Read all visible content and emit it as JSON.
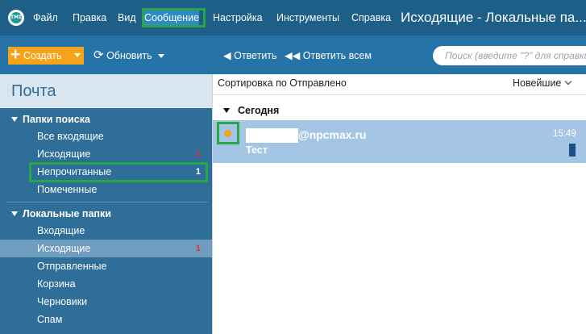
{
  "menubar": {
    "logo_text": "ΤΜΣ",
    "items": [
      "Файл",
      "Правка",
      "Вид",
      "Сообщение",
      "Настройка",
      "Инструменты",
      "Справка"
    ],
    "window_title": "Исходящие - Локальные па..."
  },
  "toolbar": {
    "create": "Создать",
    "refresh": "Обновить",
    "reply": "Ответить",
    "reply_all": "Ответить всем",
    "search_placeholder": "Поиск (введите \"?\" для справки)"
  },
  "sidebar": {
    "title": "Почта",
    "search_group": {
      "label": "Папки поиска",
      "items": [
        {
          "label": "Все входящие",
          "count": ""
        },
        {
          "label": "Исходящие",
          "count": "1"
        },
        {
          "label": "Непрочитанные",
          "count": "1"
        },
        {
          "label": "Помеченные",
          "count": ""
        }
      ]
    },
    "local_group": {
      "label": "Локальные папки",
      "items": [
        {
          "label": "Входящие",
          "count": ""
        },
        {
          "label": "Исходящие",
          "count": "1"
        },
        {
          "label": "Отправленные",
          "count": ""
        },
        {
          "label": "Корзина",
          "count": ""
        },
        {
          "label": "Черновики",
          "count": ""
        },
        {
          "label": "Спам",
          "count": ""
        }
      ]
    }
  },
  "list": {
    "sort_label": "Сортировка по Отправлено",
    "sort_order": "Новейшие",
    "group_label": "Сегодня",
    "messages": [
      {
        "sender": "@npcmax.ru",
        "subject": "Тест",
        "time": "15:49"
      }
    ]
  },
  "colors": {
    "titlebar": "#1e5f87",
    "toolbar": "#2674a7",
    "sidebar": "#2e6e99",
    "create_button": "#f6a21a",
    "highlight": "#29a746",
    "selected_row": "#a4c5e3"
  }
}
